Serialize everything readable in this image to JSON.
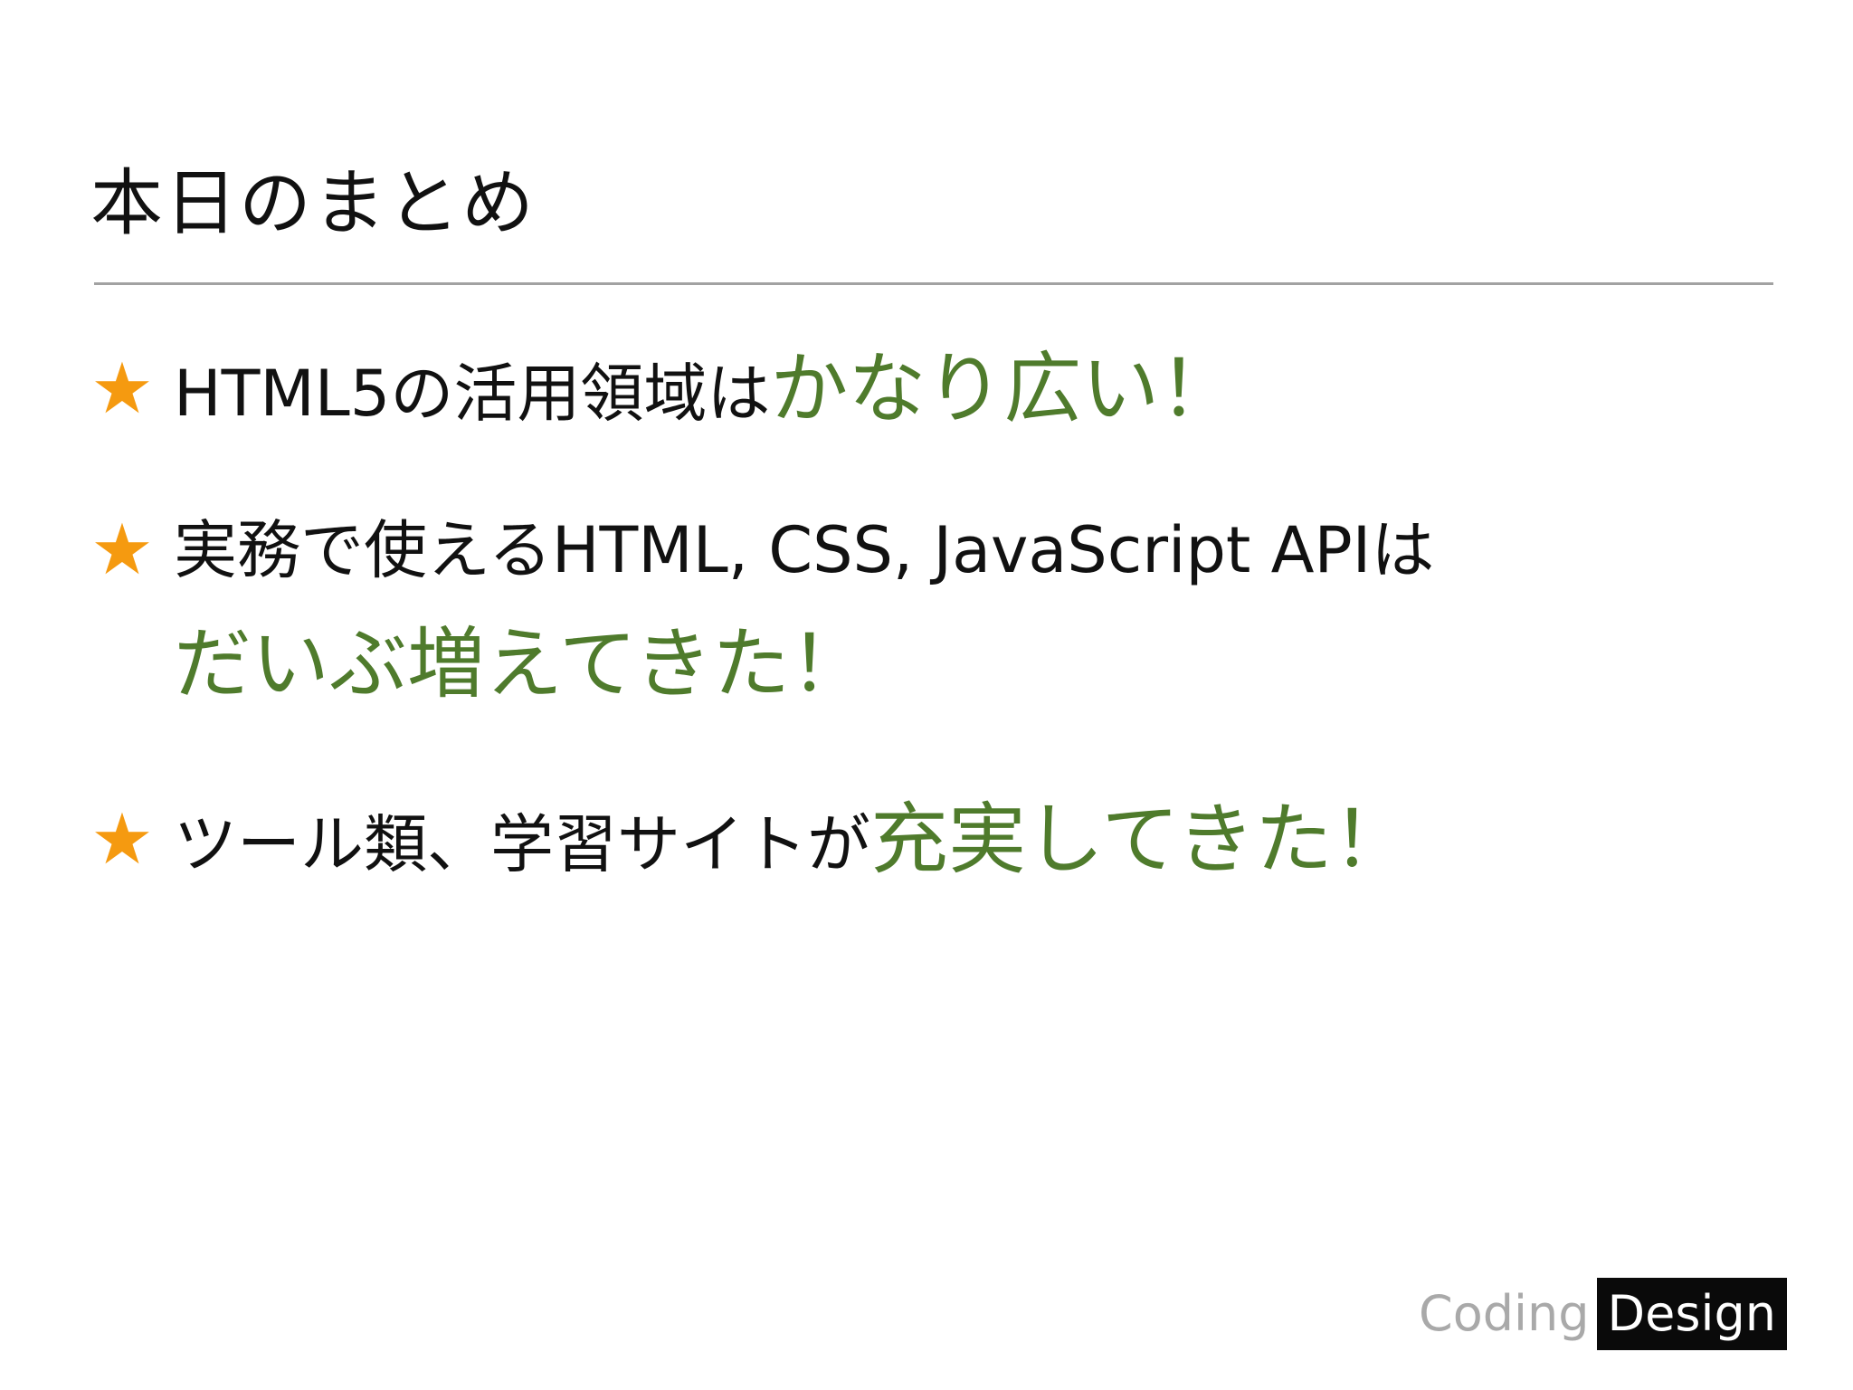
{
  "slide": {
    "title": "本日のまとめ",
    "bullets": [
      {
        "star": "★",
        "plain": "HTML5の活用領域は",
        "highlight": "かなり広い！"
      },
      {
        "star": "★",
        "plain": "実務で使えるHTML, CSS, JavaScript APIは",
        "highlight": "だいぶ増えてきた！"
      },
      {
        "star": "★",
        "plain": "ツール類、学習サイトが",
        "highlight": "充実してきた！"
      }
    ],
    "logo": {
      "word1": "Coding",
      "word2": "Design"
    },
    "colors": {
      "star": "#f59a10",
      "highlight": "#4f7b2c",
      "divider": "#a2a2a2"
    }
  }
}
